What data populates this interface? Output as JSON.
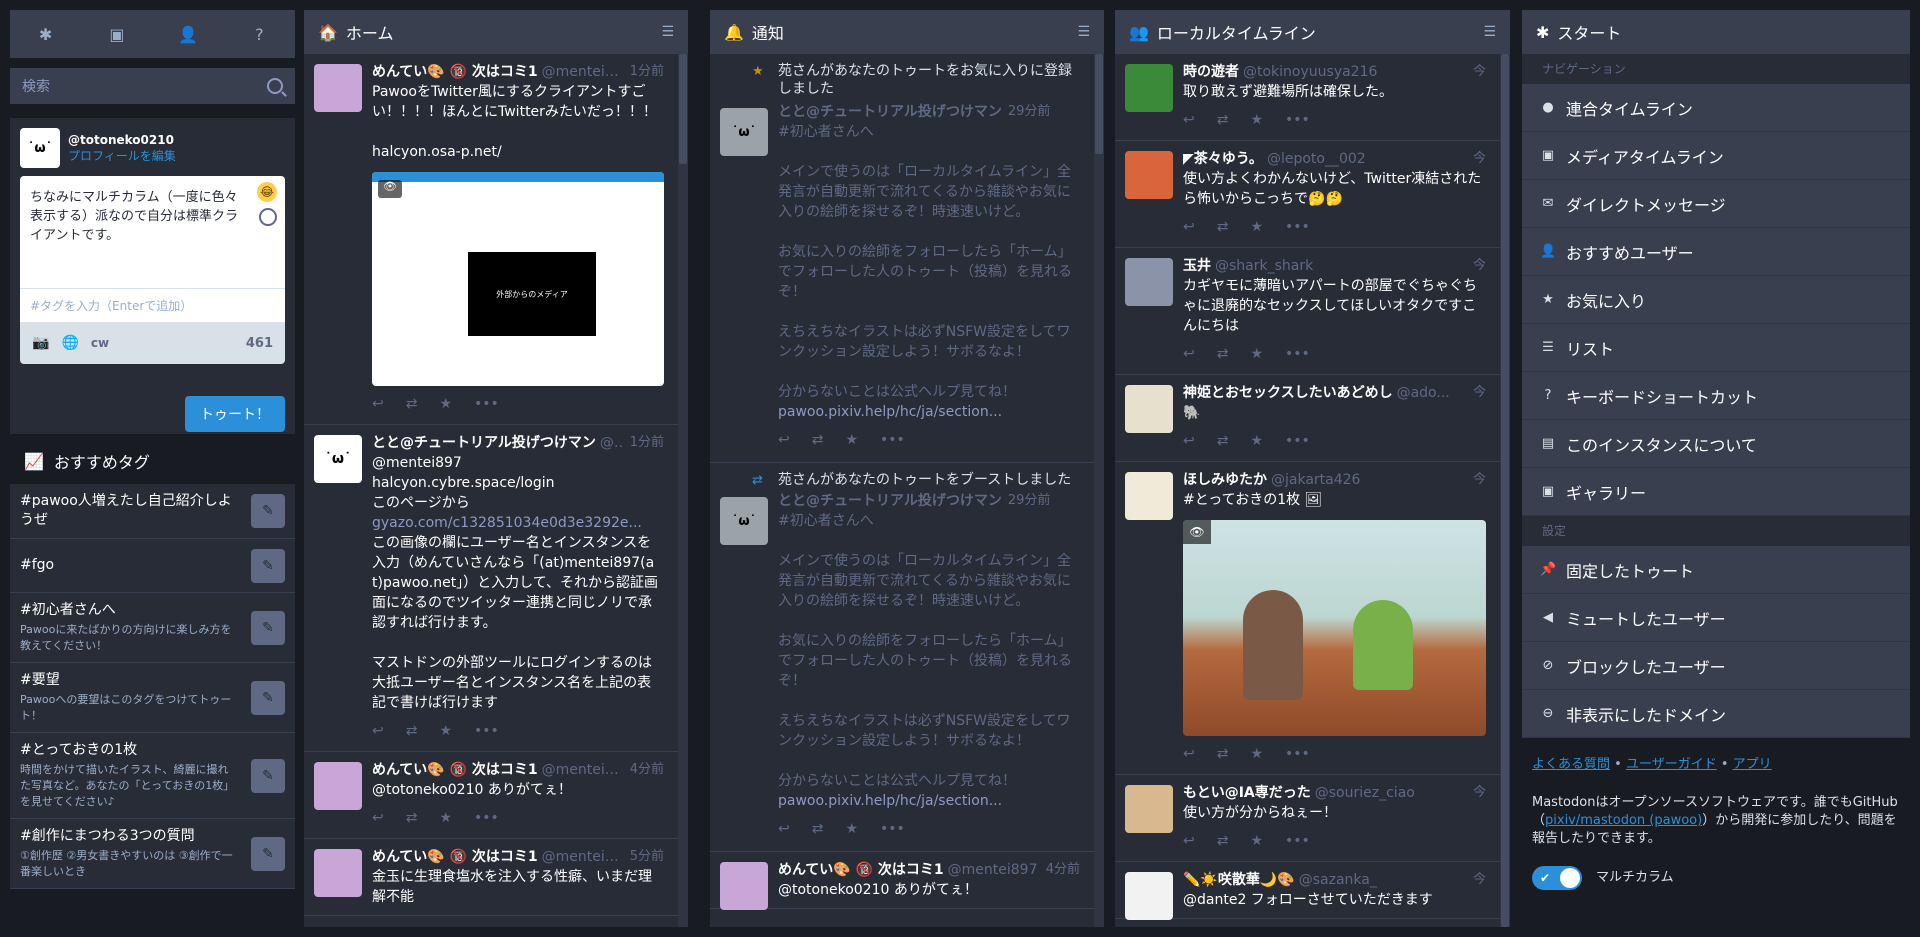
{
  "drawer": {
    "tabs": [
      "asterisk-icon",
      "image-icon",
      "user-plus-icon",
      "question-icon"
    ],
    "search_placeholder": "検索",
    "account": {
      "handle": "@totoneko0210",
      "edit": "プロフィールを編集",
      "face": "˙ω˙"
    },
    "compose": {
      "text": "ちなみにマルチカラム（一度に色々表示する）派なので自分は標準クライアントです。",
      "tag_placeholder": "#タグを入力（Enterで追加）",
      "cw": "cw",
      "count": "461",
      "toot": "トゥート！"
    },
    "tags_title": "おすすめタグ",
    "tags": [
      {
        "name": "#pawoo人増えたし自己紹介しようぜ",
        "desc": ""
      },
      {
        "name": "#fgo",
        "desc": ""
      },
      {
        "name": "#初心者さんへ",
        "desc": "Pawooに来たばかりの方向けに楽しみ方を教えてください！"
      },
      {
        "name": "#要望",
        "desc": "Pawooへの要望はこのタグをつけてトゥート！"
      },
      {
        "name": "#とっておきの1枚",
        "desc": "時間をかけて描いたイラスト、綺麗に撮れた写真など。あなたの「とっておきの1枚」を見せてください♪"
      },
      {
        "name": "#創作にまつわる3つの質問",
        "desc": "①創作歴 ②男女書きやすいのは ③創作で一番楽しいとき"
      }
    ]
  },
  "home": {
    "title": "ホーム",
    "statuses": [
      {
        "name": "めんてい🎨 🔞 次はコミ1",
        "user": "@mentei897",
        "time": "1分前",
        "text": "PawooをTwitter風にするクライアントすごい！！！！ほんとにTwitterみたいだっ！！！\n\nhalcyon.osa-p.net/"
      },
      {
        "name": "とと@チュートリアル投げつけマン",
        "user": "@...",
        "time": "1分前",
        "text1": "@mentei897\nhalcyon.cybre.space/login\nこのページから",
        "link": "gyazo.com/c132851034e0d3e3292e...",
        "text2": "この画像の欄にユーザー名とインスタンスを入力（めんていさんなら「(at)mentei897(at)pawoo.net」）と入力して、それから認証画面になるのでツイッター連携と同じノリで承認すれば行けます。\n\nマストドンの外部ツールにログインするのは大抵ユーザー名とインスタンス名を上記の表記で書けば行けます"
      },
      {
        "name": "めんてい🎨 🔞 次はコミ1",
        "user": "@mentei897",
        "time": "4分前",
        "text": "@totoneko0210 ありがてぇ！"
      },
      {
        "name": "めんてい🎨 🔞 次はコミ1",
        "user": "@mentei897",
        "time": "5分前",
        "text": "金玉に生理食塩水を注入する性癖、いまだ理解不能"
      }
    ],
    "media_label": "外部からのメディア"
  },
  "notifications": {
    "title": "通知",
    "items": [
      {
        "head": "苑さんがあなたのトゥートをお気に入りに登録しました",
        "name": "とと@チュートリアル投げつけマン",
        "time": "29分前",
        "text": "#初心者さんへ\n\nメインで使うのは「ローカルタイムライン」全発言が自動更新で流れてくるから雑談やお気に入りの絵師を探せるぞ！時速速いけど。\n\nお気に入りの絵師をフォローしたら「ホーム」でフォローした人のトゥート（投稿）を見れるぞ！\n\nえちえちなイラストは必ずNSFW設定をしてワンクッション設定しよう！サボるなよ！\n\n分からないことは公式ヘルプ見てね！",
        "link": "pawoo.pixiv.help/hc/ja/section..."
      },
      {
        "head": "苑さんがあなたのトゥートをブーストしました",
        "name": "とと@チュートリアル投げつけマン",
        "time": "29分前",
        "text": "#初心者さんへ\n\nメインで使うのは「ローカルタイムライン」全発言が自動更新で流れてくるから雑談やお気に入りの絵師を探せるぞ！時速速いけど。\n\nお気に入りの絵師をフォローしたら「ホーム」でフォローした人のトゥート（投稿）を見れるぞ！\n\nえちえちなイラストは必ずNSFW設定をしてワンクッション設定しよう！サボるなよ！\n\n分からないことは公式ヘルプ見てね！",
        "link": "pawoo.pixiv.help/hc/ja/section..."
      },
      {
        "name": "めんてい🎨 🔞 次はコミ1",
        "user": "@mentei897",
        "time": "4分前",
        "text": "@totoneko0210 ありがてぇ！"
      }
    ]
  },
  "local": {
    "title": "ローカルタイムライン",
    "statuses": [
      {
        "name": "時の遊者",
        "user": "@tokinoyuusya216",
        "time": "今",
        "text": "取り敢えず避難場所は確保した。"
      },
      {
        "name": "◤茶々ゆう。",
        "user": "@lepoto__002",
        "time": "今",
        "text": "使い方よくわかんないけど、Twitter凍結されたら怖いからこっちで🤔🤔"
      },
      {
        "name": "玉井",
        "user": "@shark_shark",
        "time": "今",
        "text": "カギヤモに薄暗いアパートの部屋でぐちゃぐちゃに退廃的なセックスしてほしいオタクですこんにちは"
      },
      {
        "name": "神姫とおセックスしたいあどめし",
        "user": "@ado...",
        "time": "今",
        "text": "🐘"
      },
      {
        "name": "ほしみゆたか",
        "user": "@jakarta426",
        "time": "今",
        "text": "#とっておきの1枚 🖼"
      },
      {
        "name": "もとい@IA専だった",
        "user": "@souriez_ciao",
        "time": "今",
        "text": "使い方が分からねぇー！"
      },
      {
        "name": "✏️☀️咲散華🌙🎨",
        "user": "@sazanka_",
        "time": "今",
        "text": "@dante2 フォローさせていただきます"
      }
    ]
  },
  "start": {
    "title": "スタート",
    "nav_label": "ナビゲーション",
    "nav": [
      {
        "icon": "globe-icon",
        "label": "連合タイムライン"
      },
      {
        "icon": "image-icon",
        "label": "メディアタイムライン"
      },
      {
        "icon": "envelope-icon",
        "label": "ダイレクトメッセージ"
      },
      {
        "icon": "user-plus-icon",
        "label": "おすすめユーザー"
      },
      {
        "icon": "star-icon",
        "label": "お気に入り"
      },
      {
        "icon": "list-icon",
        "label": "リスト"
      },
      {
        "icon": "question-icon",
        "label": "キーボードショートカット"
      },
      {
        "icon": "book-icon",
        "label": "このインスタンスについて"
      },
      {
        "icon": "image-icon",
        "label": "ギャラリー"
      }
    ],
    "settings_label": "設定",
    "settings": [
      {
        "icon": "pin-icon",
        "label": "固定したトゥート"
      },
      {
        "icon": "volume-off-icon",
        "label": "ミュートしたユーザー"
      },
      {
        "icon": "ban-icon",
        "label": "ブロックしたユーザー"
      },
      {
        "icon": "minus-circle-icon",
        "label": "非表示にしたドメイン"
      }
    ],
    "footer_links": [
      "よくある質問",
      "ユーザーガイド",
      "アプリ"
    ],
    "footer_text1": "Mastodonはオープンソースソフトウェアです。誰でもGitHub（",
    "footer_repo": "pixiv/mastodon (pawoo)",
    "footer_text2": "）から開発に参加したり、問題を報告したりできます。",
    "toggle_label": "マルチカラム"
  }
}
